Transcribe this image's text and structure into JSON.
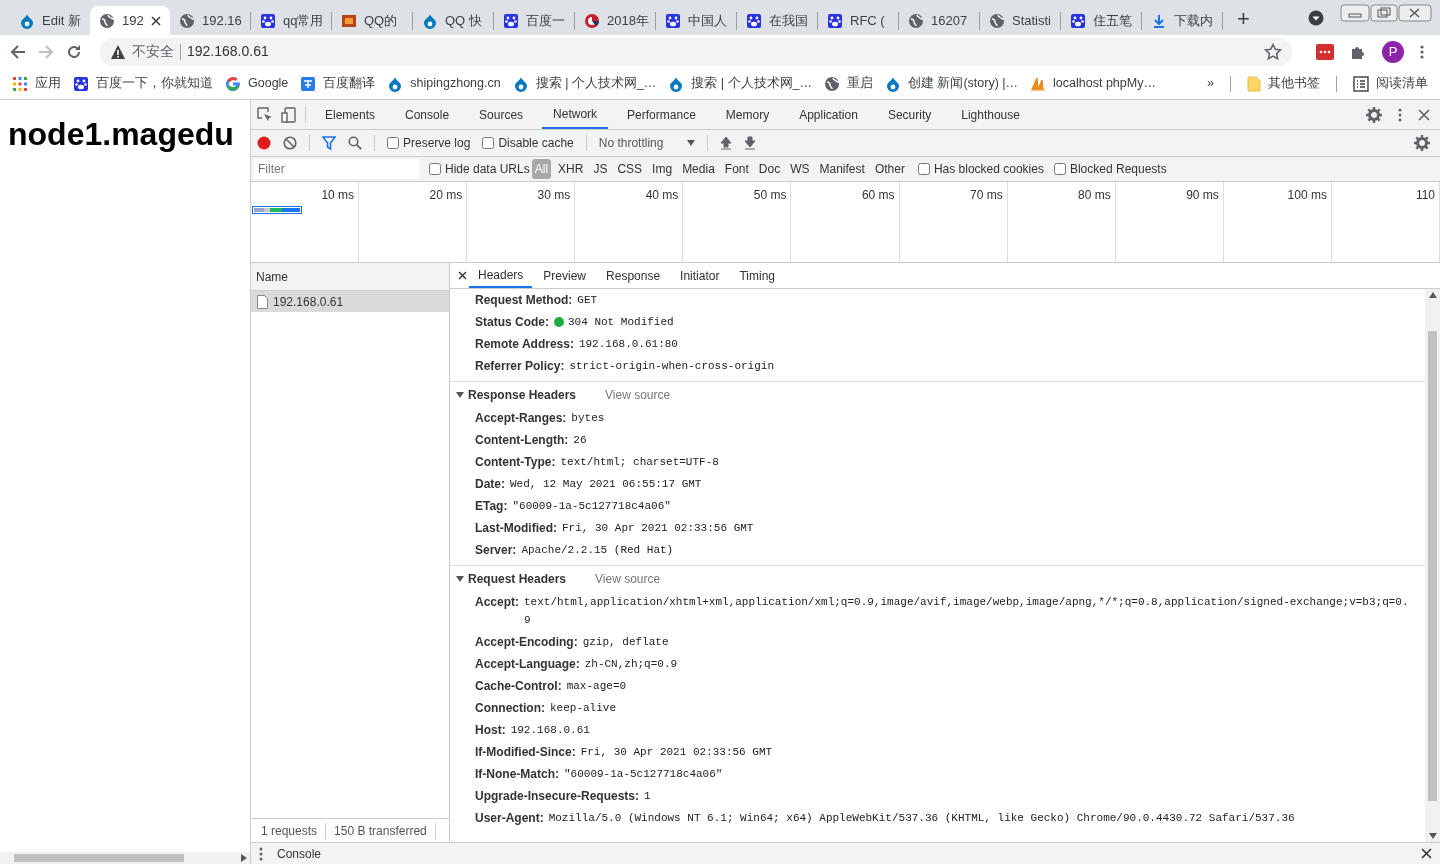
{
  "browser_tabs": [
    {
      "title": "Edit 新",
      "kind": "drupal",
      "selected": false
    },
    {
      "title": "192",
      "kind": "globe",
      "selected": true
    },
    {
      "title": "192.16",
      "kind": "globe",
      "selected": false
    },
    {
      "title": "qq常用",
      "kind": "baidu",
      "selected": false
    },
    {
      "title": "QQ的",
      "kind": "jb",
      "selected": false
    },
    {
      "title": "QQ 快",
      "kind": "drupal",
      "selected": false
    },
    {
      "title": "百度一",
      "kind": "baidu",
      "selected": false
    },
    {
      "title": "2018年",
      "kind": "redcircle",
      "selected": false
    },
    {
      "title": "中国人",
      "kind": "baidu",
      "selected": false
    },
    {
      "title": "在我国",
      "kind": "baidu",
      "selected": false
    },
    {
      "title": "RFC (",
      "kind": "baidu",
      "selected": false
    },
    {
      "title": "16207",
      "kind": "globe",
      "selected": false
    },
    {
      "title": "Statisti",
      "kind": "globe",
      "selected": false
    },
    {
      "title": "住五笔",
      "kind": "baidu",
      "selected": false
    },
    {
      "title": "下载内",
      "kind": "download",
      "selected": false
    }
  ],
  "new_tab": "+",
  "address_bar": {
    "security_label": "不安全",
    "url": "192.168.0.61"
  },
  "profile": {
    "initial": "P"
  },
  "bookmarks": [
    {
      "label": "应用",
      "kind": "apps"
    },
    {
      "label": "百度一下，你就知道",
      "kind": "baidu"
    },
    {
      "label": "Google",
      "kind": "google"
    },
    {
      "label": "百度翻译",
      "kind": "translate"
    },
    {
      "label": "shipingzhong.cn",
      "kind": "drupal"
    },
    {
      "label": "搜索 | 个人技术网_…",
      "kind": "drupal"
    },
    {
      "label": "搜索 | 个人技术网_…",
      "kind": "drupal"
    },
    {
      "label": "重启",
      "kind": "globe"
    },
    {
      "label": "创建 新闻(story) |…",
      "kind": "drupal"
    },
    {
      "label": "localhost phpMy…",
      "kind": "pma"
    }
  ],
  "bookmarks_overflow": "»",
  "other_bookmarks": "其他书签",
  "reading_list": "阅读清单",
  "page": {
    "heading": "node1.magedu"
  },
  "devtools": {
    "panels": [
      {
        "label": "Elements",
        "selected": false
      },
      {
        "label": "Console",
        "selected": false
      },
      {
        "label": "Sources",
        "selected": false
      },
      {
        "label": "Network",
        "selected": true
      },
      {
        "label": "Performance",
        "selected": false
      },
      {
        "label": "Memory",
        "selected": false
      },
      {
        "label": "Application",
        "selected": false
      },
      {
        "label": "Security",
        "selected": false
      },
      {
        "label": "Lighthouse",
        "selected": false
      }
    ],
    "network_toolbar": {
      "recording": true,
      "filter_active": true,
      "options": [
        {
          "label": "Preserve log",
          "checked": false
        },
        {
          "label": "Disable cache",
          "checked": false
        }
      ],
      "throttling": "No throttling"
    },
    "filter_bar": {
      "placeholder": "Filter",
      "hide_data_urls": {
        "label": "Hide data URLs",
        "checked": false
      },
      "types": [
        {
          "label": "All",
          "selected": true
        },
        {
          "label": "XHR",
          "selected": false
        },
        {
          "label": "JS",
          "selected": false
        },
        {
          "label": "CSS",
          "selected": false
        },
        {
          "label": "Img",
          "selected": false
        },
        {
          "label": "Media",
          "selected": false
        },
        {
          "label": "Font",
          "selected": false
        },
        {
          "label": "Doc",
          "selected": false
        },
        {
          "label": "WS",
          "selected": false
        },
        {
          "label": "Manifest",
          "selected": false
        },
        {
          "label": "Other",
          "selected": false
        }
      ],
      "extra_options": [
        {
          "label": "Has blocked cookies",
          "checked": false
        },
        {
          "label": "Blocked Requests",
          "checked": false
        }
      ]
    },
    "timeline_ticks": [
      "10 ms",
      "20 ms",
      "30 ms",
      "40 ms",
      "50 ms",
      "60 ms",
      "70 ms",
      "80 ms",
      "90 ms",
      "100 ms",
      "110"
    ],
    "requests_table": {
      "column": "Name",
      "rows": [
        {
          "name": "192.168.0.61",
          "selected": true
        }
      ]
    },
    "detail_tabs": [
      {
        "label": "Headers",
        "selected": true
      },
      {
        "label": "Preview",
        "selected": false
      },
      {
        "label": "Response",
        "selected": false
      },
      {
        "label": "Initiator",
        "selected": false
      },
      {
        "label": "Timing",
        "selected": false
      }
    ],
    "general": [
      {
        "name": "Request Method:",
        "value": "GET"
      },
      {
        "name": "Status Code:",
        "value": "304 Not Modified",
        "color": "#1fae3f"
      },
      {
        "name": "Remote Address:",
        "value": "192.168.0.61:80"
      },
      {
        "name": "Referrer Policy:",
        "value": "strict-origin-when-cross-origin"
      }
    ],
    "sections": [
      {
        "title": "Response Headers",
        "expanded": true,
        "view_source": "View source",
        "headers": [
          {
            "name": "Accept-Ranges:",
            "value": "bytes"
          },
          {
            "name": "Content-Length:",
            "value": "26"
          },
          {
            "name": "Content-Type:",
            "value": "text/html; charset=UTF-8"
          },
          {
            "name": "Date:",
            "value": "Wed, 12 May 2021 06:55:17 GMT"
          },
          {
            "name": "ETag:",
            "value": "\"60009-1a-5c127718c4a06\""
          },
          {
            "name": "Last-Modified:",
            "value": "Fri, 30 Apr 2021 02:33:56 GMT"
          },
          {
            "name": "Server:",
            "value": "Apache/2.2.15 (Red Hat)"
          }
        ]
      },
      {
        "title": "Request Headers",
        "expanded": true,
        "view_source": "View source",
        "headers": [
          {
            "name": "Accept:",
            "value": "text/html,application/xhtml+xml,application/xml;q=0.9,image/avif,image/webp,image/apng,*/*;q=0.8,application/signed-exchange;v=b3;q=0.9"
          },
          {
            "name": "Accept-Encoding:",
            "value": "gzip, deflate"
          },
          {
            "name": "Accept-Language:",
            "value": "zh-CN,zh;q=0.9"
          },
          {
            "name": "Cache-Control:",
            "value": "max-age=0"
          },
          {
            "name": "Connection:",
            "value": "keep-alive"
          },
          {
            "name": "Host:",
            "value": "192.168.0.61"
          },
          {
            "name": "If-Modified-Since:",
            "value": "Fri, 30 Apr 2021 02:33:56 GMT"
          },
          {
            "name": "If-None-Match:",
            "value": "\"60009-1a-5c127718c4a06\""
          },
          {
            "name": "Upgrade-Insecure-Requests:",
            "value": "1"
          },
          {
            "name": "User-Agent:",
            "value": "Mozilla/5.0 (Windows NT 6.1; Win64; x64) AppleWebKit/537.36 (KHTML, like Gecko) Chrome/90.0.4430.72 Safari/537.36"
          }
        ]
      }
    ],
    "summary": [
      "1 requests",
      "150 B transferred"
    ],
    "drawer_tab": "Console"
  }
}
